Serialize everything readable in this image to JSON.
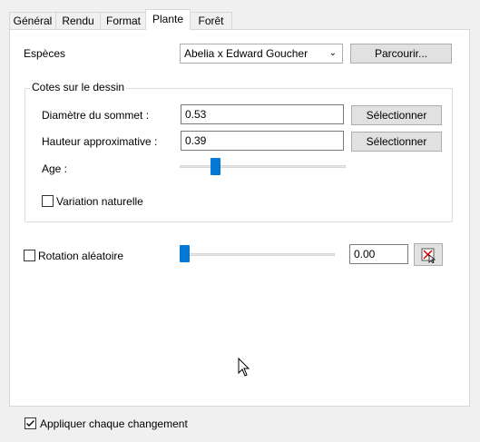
{
  "tabs": [
    "Général",
    "Rendu",
    "Format",
    "Plante",
    "Forêt"
  ],
  "species": {
    "label": "Espèces",
    "selected": "Abelia x Edward Goucher",
    "browse_button": "Parcourir..."
  },
  "dimensions_group": {
    "title": "Cotes sur le dessin",
    "diameter_label": "Diamètre du sommet :",
    "diameter_value": "0.53",
    "height_label": "Hauteur approximative :",
    "height_value": "0.39",
    "select_button": "Sélectionner",
    "age_label": "Age :",
    "age_slider_level": 0.2,
    "variation_label": "Variation naturelle",
    "variation_checked": false
  },
  "rotation": {
    "label": "Rotation aléatoire",
    "checked": false,
    "value": "0.00",
    "slider_level": 0.0
  },
  "apply_each_change": {
    "label": "Appliquer chaque changement",
    "checked": true
  },
  "colors": {
    "accent": "#0078d7",
    "panel_bg": "#ffffff",
    "window_bg": "#f0f0f0"
  }
}
